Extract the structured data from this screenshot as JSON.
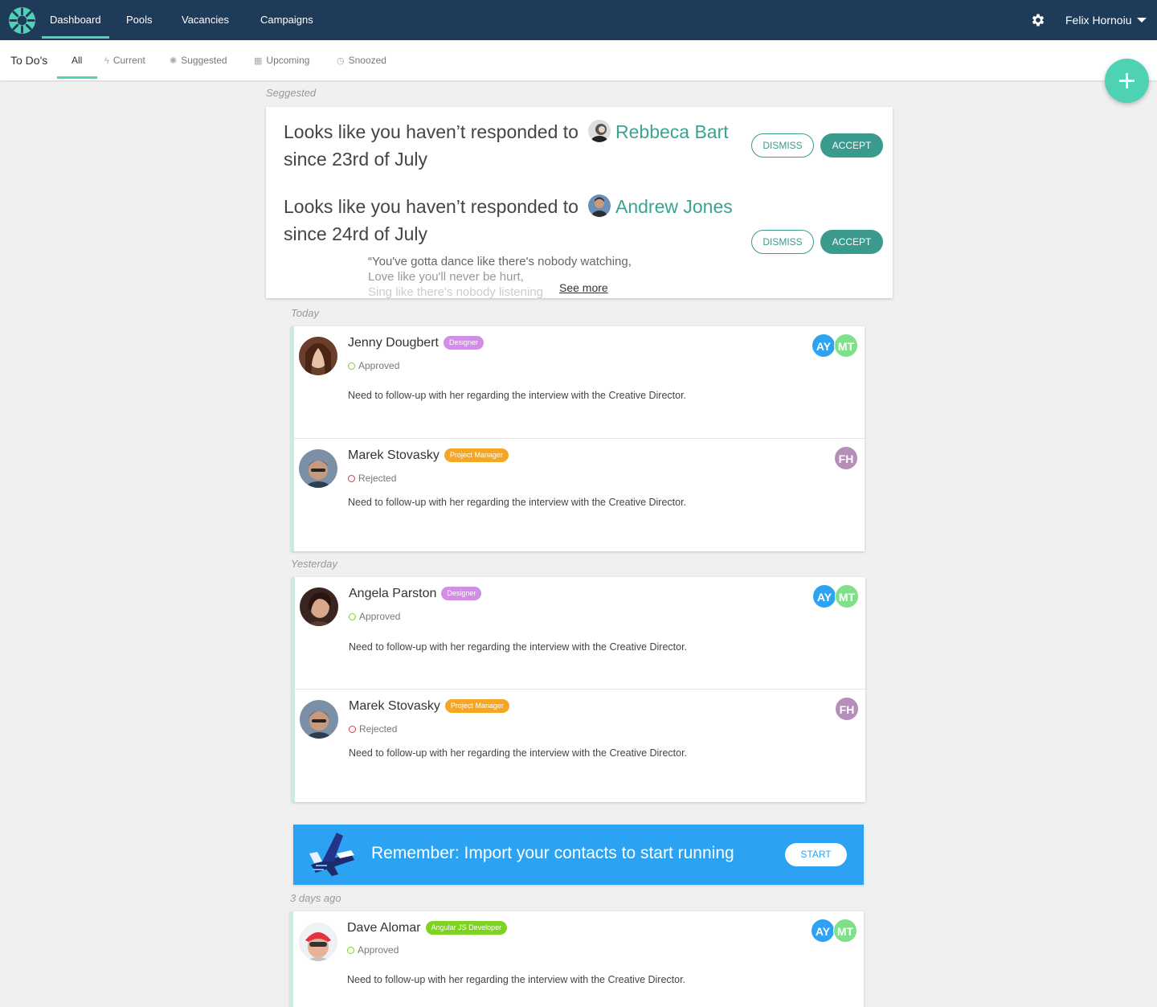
{
  "topnav": {
    "items": [
      "Dashboard",
      "Pools",
      "Vacancies",
      "Campaigns"
    ],
    "user_name": "Felix Hornoiu"
  },
  "subnav": {
    "title": "To Do's",
    "tabs": [
      "All",
      "Current",
      "Suggested",
      "Upcoming",
      "Snoozed"
    ],
    "active_tab": "All"
  },
  "sections": {
    "suggested": "Seggested",
    "today": "Today",
    "yesterday": "Yesterday",
    "three_days": "3 days ago"
  },
  "suggestions": [
    {
      "prefix": "Looks like you haven’t responded to",
      "person": "Rebbeca Bart",
      "since": "since 23rd of July",
      "dismiss": "DISMISS",
      "accept": "ACCEPT"
    },
    {
      "prefix": "Looks like you haven’t responded to",
      "person": "Andrew Jones",
      "since": "since 24rd of July",
      "dismiss": "DISMISS",
      "accept": "ACCEPT",
      "quote_lines": [
        "“You've gotta dance like there's nobody watching,",
        "Love like you'll never be hurt,",
        "Sing like there's nobody listening"
      ],
      "see_more": "See more"
    }
  ],
  "today": [
    {
      "name": "Jenny Dougbert",
      "badge": "Designer",
      "status": "Approved",
      "note": "Need to follow-up with her regarding the interview with the Creative Director.",
      "assignees": [
        "AY",
        "MT"
      ]
    },
    {
      "name": "Marek Stovasky",
      "badge": "Project Manager",
      "status": "Rejected",
      "note": "Need to follow-up with her regarding the interview with the Creative Director.",
      "assignees": [
        "FH"
      ]
    }
  ],
  "yesterday": [
    {
      "name": "Angela Parston",
      "badge": "Designer",
      "status": "Approved",
      "note": "Need to follow-up with her regarding the interview with the Creative Director.",
      "assignees": [
        "AY",
        "MT"
      ]
    },
    {
      "name": "Marek Stovasky",
      "badge": "Project Manager",
      "status": "Rejected",
      "note": "Need to follow-up with her regarding the interview with the Creative Director.",
      "assignees": [
        "FH"
      ]
    }
  ],
  "banner": {
    "text": "Remember: Import your contacts to start running",
    "button": "START"
  },
  "three_days": [
    {
      "name": "Dave Alomar",
      "badge": "Angular JS Developer",
      "status": "Approved",
      "note": "Need to follow-up with her regarding the interview with the Creative Director.",
      "assignees": [
        "AY",
        "MT"
      ]
    }
  ],
  "colors": {
    "navbar": "#1f3b5a",
    "accent": "#4fd1b4",
    "teal_button": "#3a9a8c",
    "banner": "#2ba3f2",
    "badge_designer": "#d28ee6",
    "badge_pm": "#f5a623",
    "badge_angular": "#7ed321"
  },
  "icons": [
    "logo-icon",
    "gear-icon",
    "caret-down-icon",
    "lightning-icon",
    "bulb-icon",
    "calendar-icon",
    "clock-icon",
    "plus-icon",
    "airplane-icon"
  ]
}
